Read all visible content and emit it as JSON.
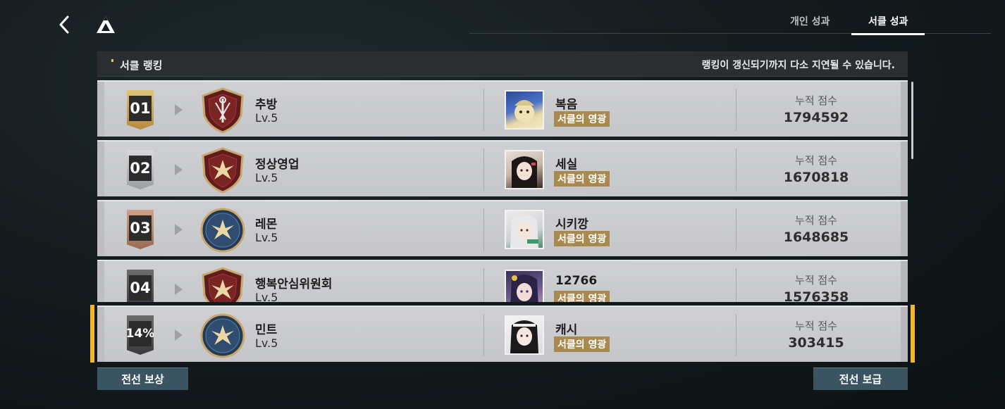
{
  "tabs": [
    {
      "label": "개인 성과",
      "active": false
    },
    {
      "label": "서클 성과",
      "active": true
    }
  ],
  "header": {
    "title": "서클 랭킹",
    "note": "랭킹이 갱신되기까지 다소 지연될 수 있습니다."
  },
  "ranking": [
    {
      "rank": "01",
      "circle_name": "추방",
      "level": "Lv.5",
      "leader": "복음",
      "leader_tag": "서클의 영광",
      "score_label": "누적 점수",
      "score": "1794592",
      "emblem": "red-shield-swords-icon"
    },
    {
      "rank": "02",
      "circle_name": "정상영업",
      "level": "Lv.5",
      "leader": "세실",
      "leader_tag": "서클의 영광",
      "score_label": "누적 점수",
      "score": "1670818",
      "emblem": "red-shield-eagle-icon"
    },
    {
      "rank": "03",
      "circle_name": "레몬",
      "level": "Lv.5",
      "leader": "시키깡",
      "leader_tag": "서클의 영광",
      "score_label": "누적 점수",
      "score": "1648685",
      "emblem": "blue-circle-eagle-icon"
    },
    {
      "rank": "04",
      "circle_name": "행복안심위원회",
      "level": "Lv.5",
      "leader": "12766",
      "leader_tag": "서클의 영광",
      "score_label": "누적 점수",
      "score": "1576358",
      "emblem": "red-shield-eagle-icon"
    }
  ],
  "my_circle": {
    "rank": "14%",
    "circle_name": "민트",
    "level": "Lv.5",
    "leader": "캐시",
    "leader_tag": "서클의 영광",
    "score_label": "누적 점수",
    "score": "303415",
    "emblem": "blue-circle-eagle-icon"
  },
  "buttons": {
    "reward": "전선 보상",
    "supply": "전선 보급"
  },
  "colors": {
    "highlight": "#f2b82a",
    "tag": "#a8894f",
    "button": "#3b5461"
  }
}
